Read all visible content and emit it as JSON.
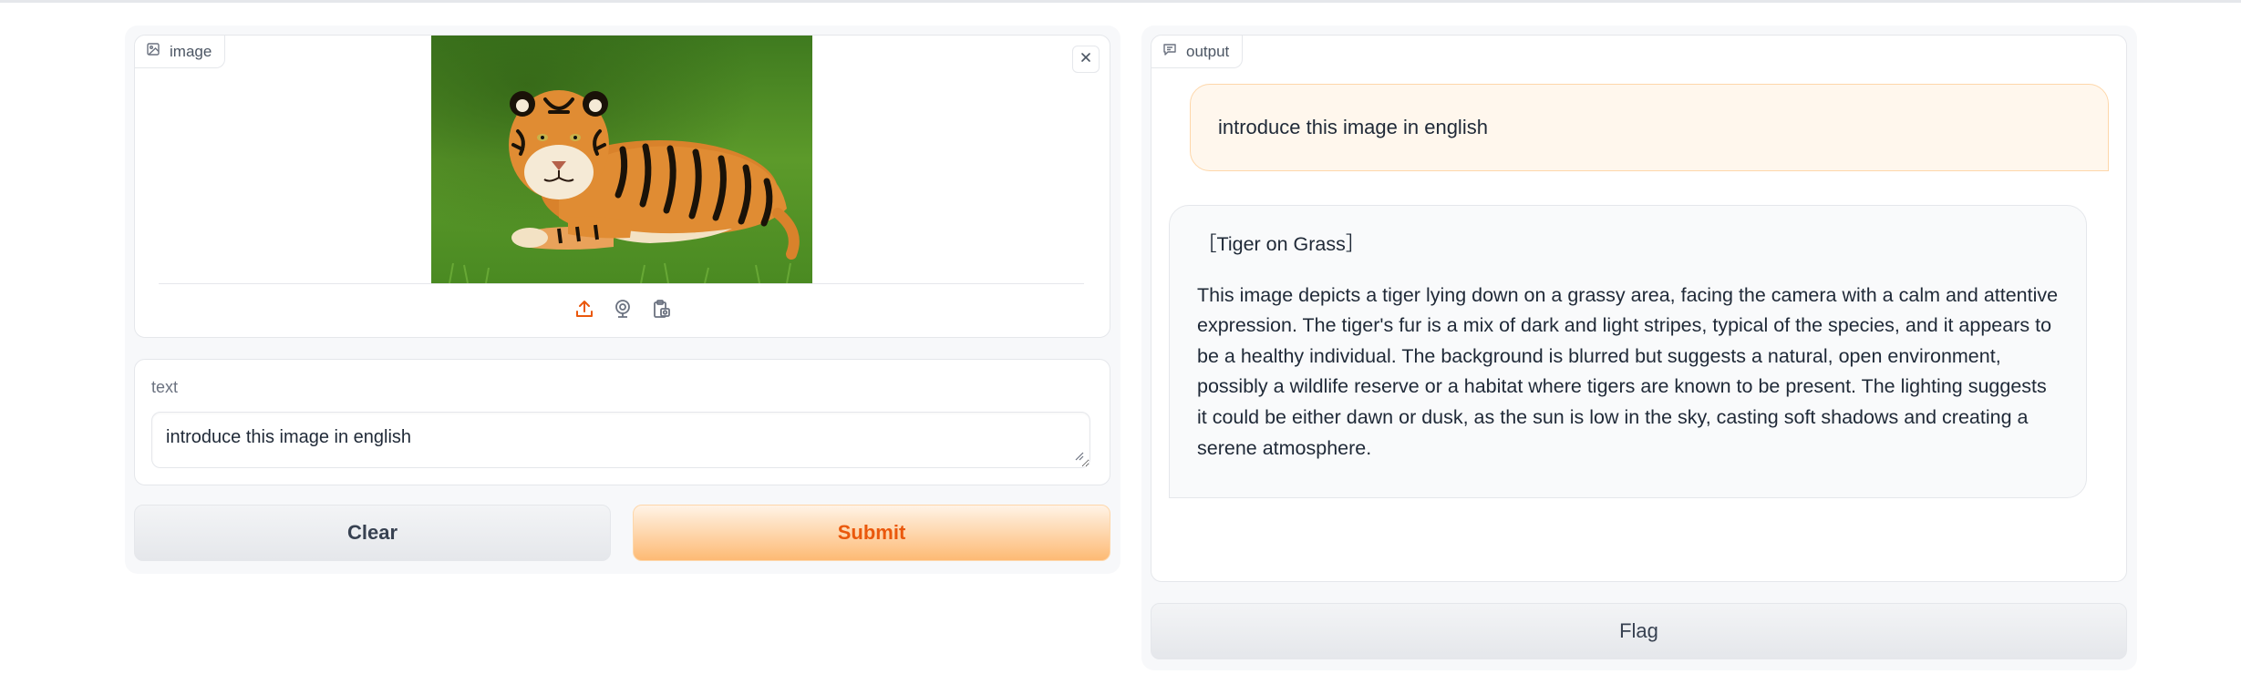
{
  "input_column": {
    "image_block": {
      "label": "image",
      "icon": "image-icon",
      "close_icon": "close-icon",
      "source_icons": [
        "upload-icon",
        "webcam-icon",
        "clipboard-icon"
      ],
      "photo_subject": "tiger lying on grass"
    },
    "text_block": {
      "label": "text",
      "value": "introduce this image in english"
    },
    "buttons": {
      "clear_label": "Clear",
      "submit_label": "Submit"
    }
  },
  "output_column": {
    "label": "output",
    "icon": "chat-icon",
    "messages": [
      {
        "role": "user",
        "text": "introduce this image in english"
      },
      {
        "role": "assistant",
        "title": "［Tiger on Grass］",
        "body": "This image depicts a tiger lying down on a grassy area, facing the camera with a calm and attentive expression. The tiger's fur is a mix of dark and light stripes, typical of the species, and it appears to be a healthy individual. The background is blurred but suggests a natural, open environment, possibly a wildlife reserve or a habitat where tigers are known to be present. The lighting suggests it could be either dawn or dusk, as the sun is low in the sky, casting soft shadows and creating a serene atmosphere."
      }
    ],
    "flag_label": "Flag"
  },
  "colors": {
    "accent": "#ea580c",
    "accent_light": "#fdba74",
    "user_bubble": "#fff7ed",
    "bot_bubble": "#f9fafb",
    "border": "#e5e7eb"
  }
}
